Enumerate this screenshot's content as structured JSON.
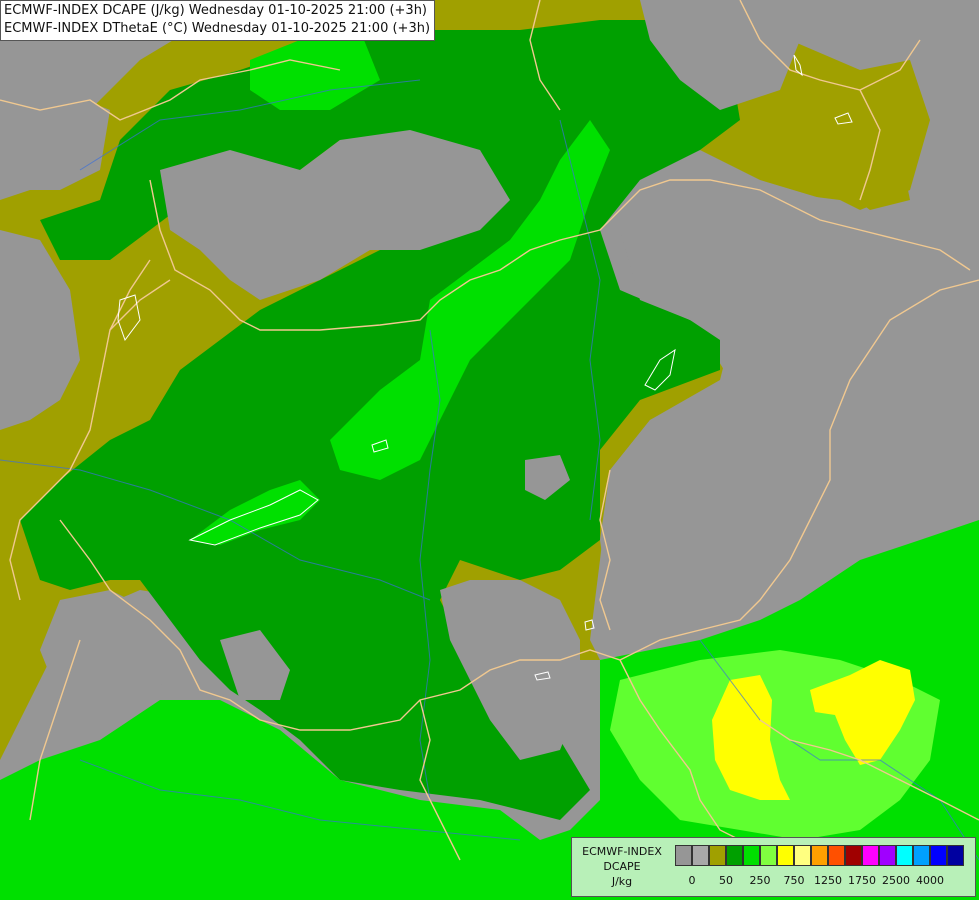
{
  "title_lines": [
    "ECMWF-INDEX DCAPE (J/kg) Wednesday 01-10-2025 21:00 (+3h)",
    "ECMWF-INDEX DThetaE (°C) Wednesday 01-10-2025 21:00 (+3h)"
  ],
  "legend": {
    "title": "ECMWF-INDEX",
    "subtitle": "DCAPE",
    "unit": "J/kg",
    "colors": [
      "#969696",
      "#a8a8a8",
      "#a0a000",
      "#00a000",
      "#00e000",
      "#80ff40",
      "#ffff00",
      "#ffff80",
      "#ffa000",
      "#ff5000",
      "#a00000",
      "#ff00ff",
      "#a000ff",
      "#00ffff",
      "#00a0ff",
      "#0000ff",
      "#0000a0"
    ],
    "tick_labels": [
      "0",
      "50",
      "250",
      "750",
      "1250",
      "1750",
      "2500",
      "4000"
    ]
  },
  "colors": {
    "no_data": "#969696",
    "olive": "#a0a000",
    "dark_green": "#00a000",
    "mid_green": "#00e000",
    "light_green": "#60ff30",
    "yellow": "#ffff00",
    "border": "#f0c890",
    "river": "#3a6fd8"
  }
}
